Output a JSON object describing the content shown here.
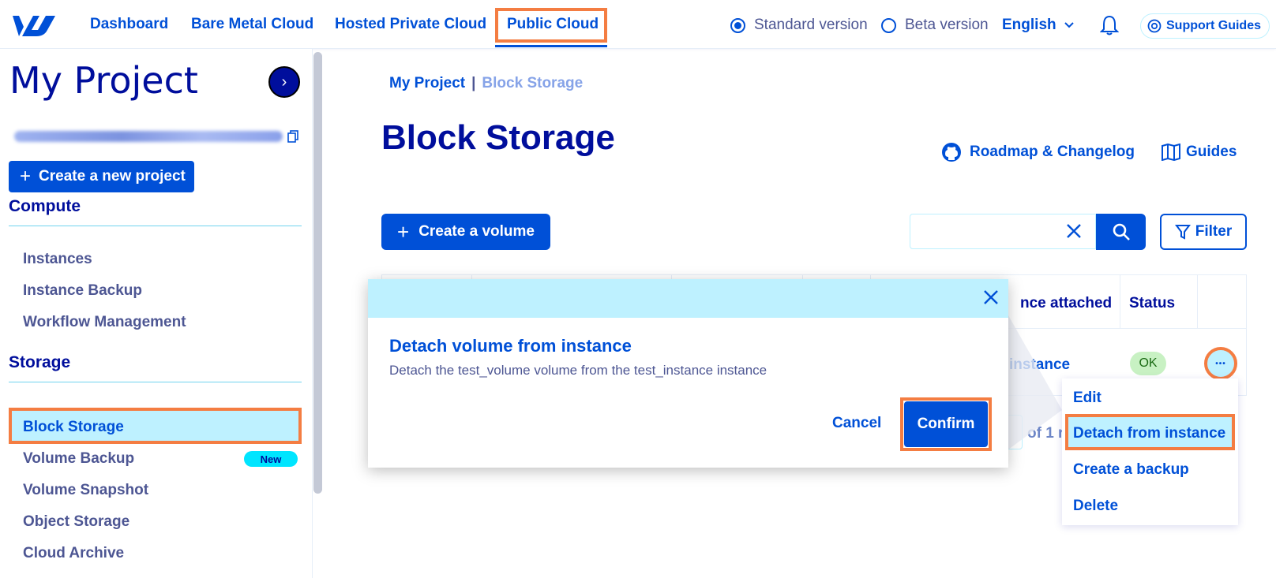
{
  "nav": {
    "links": [
      "Dashboard",
      "Bare Metal Cloud",
      "Hosted Private Cloud",
      "Public Cloud"
    ],
    "active": "Public Cloud",
    "version_standard": "Standard version",
    "version_beta": "Beta version",
    "selected_version": "Standard version",
    "language": "English",
    "support": "Support Guides"
  },
  "sidebar": {
    "project_title": "My Project",
    "create_project": "Create a new project",
    "compute": {
      "title": "Compute",
      "items": [
        "Instances",
        "Instance Backup",
        "Workflow Management"
      ]
    },
    "storage": {
      "title": "Storage",
      "items": [
        "Block Storage",
        "Volume Backup",
        "Volume Snapshot",
        "Object Storage",
        "Cloud Archive"
      ],
      "active": "Block Storage",
      "new_badge": "New"
    }
  },
  "main": {
    "breadcrumb": {
      "root": "My Project",
      "separator": "|",
      "current": "Block Storage"
    },
    "title": "Block Storage",
    "roadmap": "Roadmap & Changelog",
    "guides": "Guides",
    "create_volume": "Create a volume",
    "filter": "Filter",
    "table": {
      "headers": [
        "nce attached",
        "Status"
      ],
      "row": {
        "instance_fragment": "instance",
        "status": "OK"
      }
    },
    "pager": "of 1 r"
  },
  "actions_menu": {
    "items": [
      "Edit",
      "Detach from instance",
      "Create a backup",
      "Delete"
    ],
    "active": "Detach from instance",
    "trigger": "•••"
  },
  "modal": {
    "title": "Detach volume from instance",
    "description": "Detach the test_volume volume from the test_instance instance",
    "cancel": "Cancel",
    "confirm": "Confirm"
  },
  "colors": {
    "primary": "#0050d7",
    "navy": "#000e9c",
    "highlight": "#f47d42",
    "light_blue": "#bef1ff"
  }
}
